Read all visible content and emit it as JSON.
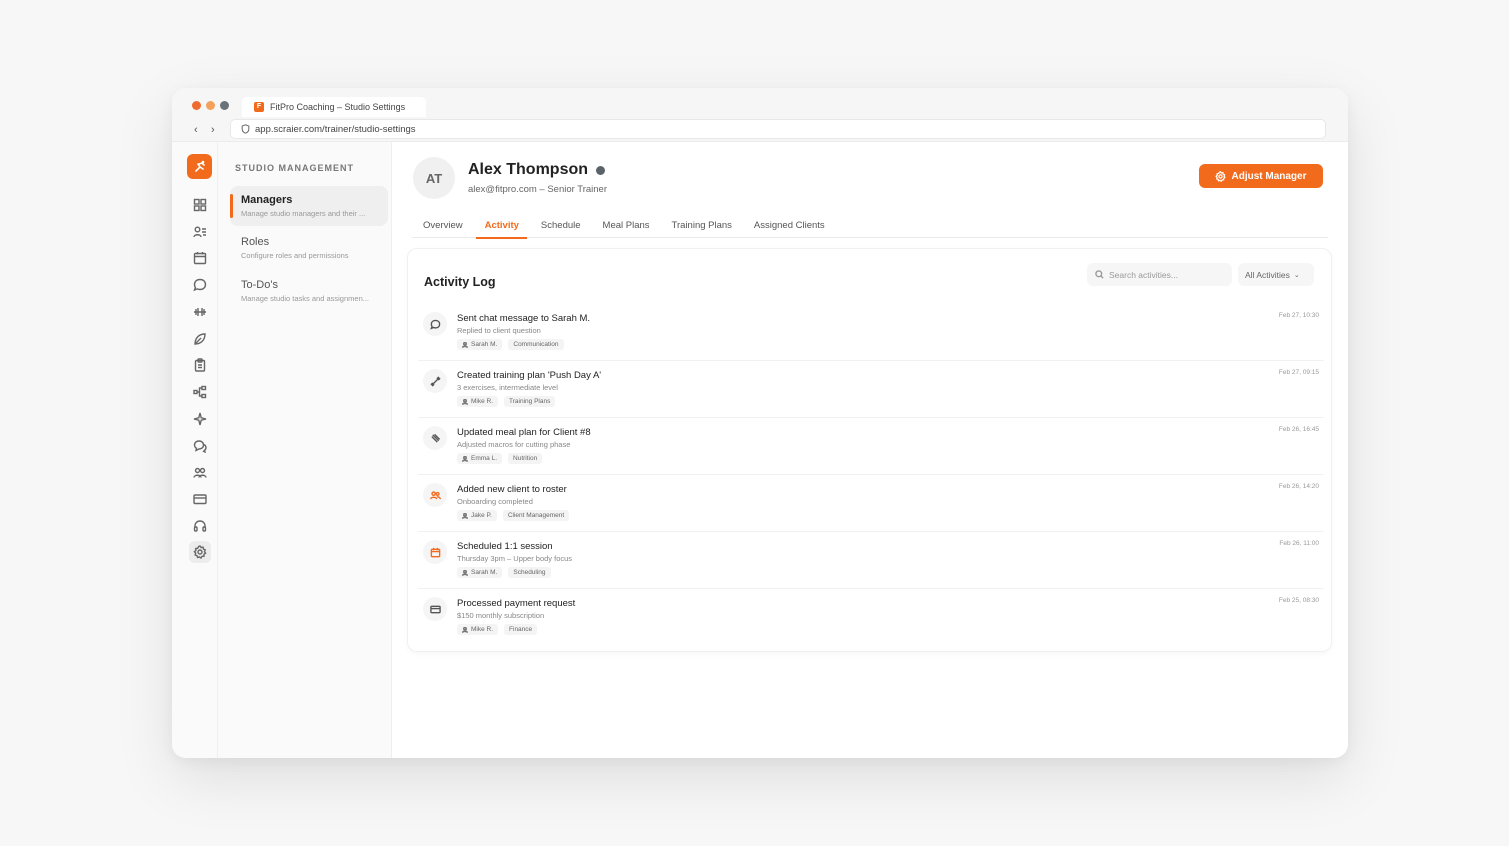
{
  "browser": {
    "tab_title": "FitPro Coaching – Studio Settings",
    "favicon_letter": "F",
    "url": "app.scraier.com/trainer/studio-settings",
    "back_glyph": "‹",
    "forward_glyph": "›"
  },
  "rail": {
    "icons": [
      "dashboard-icon",
      "clients-icon",
      "calendar-icon",
      "chat-icon",
      "dumbbell-icon",
      "nutrition-icon",
      "clipboard-icon",
      "workflow-icon",
      "sparkle-icon",
      "messages-icon",
      "team-icon",
      "billing-icon",
      "support-icon",
      "settings-icon"
    ],
    "active": "settings-icon"
  },
  "submenu": {
    "heading": "STUDIO MANAGEMENT",
    "items": [
      {
        "title": "Managers",
        "desc": "Manage studio managers and their ..."
      },
      {
        "title": "Roles",
        "desc": "Configure roles and permissions"
      },
      {
        "title": "To-Do's",
        "desc": "Manage studio tasks and assignmen..."
      }
    ]
  },
  "profile": {
    "initials": "AT",
    "name": "Alex Thompson",
    "subtitle": "alex@fitpro.com – Senior Trainer",
    "action_label": "Adjust Manager"
  },
  "tabs": [
    "Overview",
    "Activity",
    "Schedule",
    "Meal Plans",
    "Training Plans",
    "Assigned Clients"
  ],
  "active_tab": "Activity",
  "activity": {
    "title": "Activity Log",
    "search_placeholder": "Search activities...",
    "filter_label": "All Activities",
    "filter_chevron": "⌄",
    "items": [
      {
        "icon": "chat-bubble-icon",
        "title": "Sent chat message to Sarah M.",
        "desc": "Replied to client question",
        "person": "Sarah M.",
        "category": "Communication",
        "time": "Feb 27, 10:30"
      },
      {
        "icon": "dumbbell-icon",
        "title": "Created training plan 'Push Day A'",
        "desc": "3 exercises, intermediate level",
        "person": "Mike R.",
        "category": "Training Plans",
        "time": "Feb 27, 09:15"
      },
      {
        "icon": "utensils-icon",
        "title": "Updated meal plan for Client #8",
        "desc": "Adjusted macros for cutting phase",
        "person": "Emma L.",
        "category": "Nutrition",
        "time": "Feb 26, 16:45"
      },
      {
        "icon": "users-icon",
        "title": "Added new client to roster",
        "desc": "Onboarding completed",
        "person": "Jake P.",
        "category": "Client Management",
        "time": "Feb 26, 14:20"
      },
      {
        "icon": "calendar-icon",
        "title": "Scheduled 1:1 session",
        "desc": "Thursday 3pm – Upper body focus",
        "person": "Sarah M.",
        "category": "Scheduling",
        "time": "Feb 26, 11:00"
      },
      {
        "icon": "credit-card-icon",
        "title": "Processed payment request",
        "desc": "$150 monthly subscription",
        "person": "Mike R.",
        "category": "Finance",
        "time": "Feb 25, 08:30"
      }
    ]
  },
  "colors": {
    "accent": "#f26a1b",
    "online": "#5a6468"
  }
}
